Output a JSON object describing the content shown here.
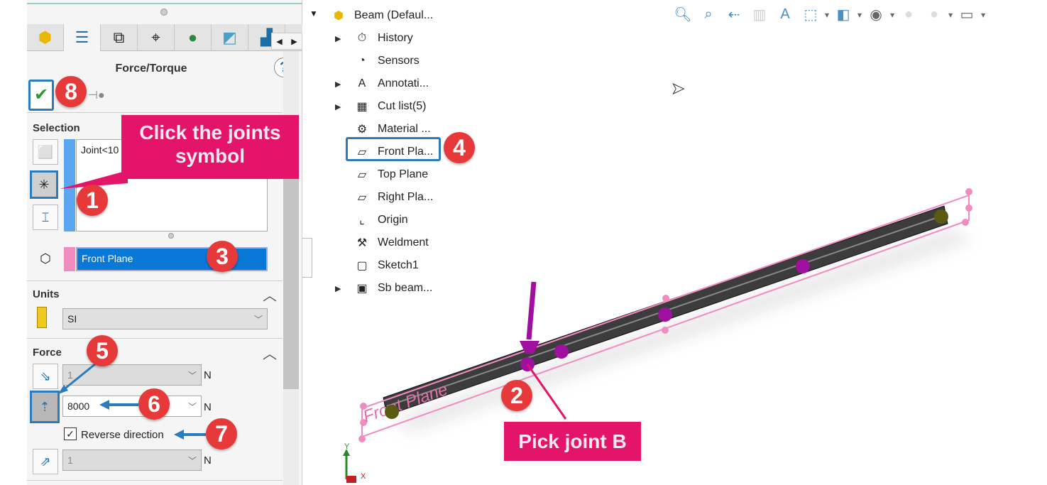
{
  "panel": {
    "title": "Force/Torque",
    "help_icon": "question-icon",
    "tabs": [
      "part-icon",
      "property-manager-icon",
      "config-icon",
      "dimxpert-icon",
      "appearance-icon",
      "display-pane-icon",
      "cam-icon"
    ],
    "selection": {
      "label": "Selection",
      "joints_value": "Joint<10",
      "plane_value": "Front Plane",
      "accent": "#5aa6f0",
      "plane_color": "#f08cc0"
    },
    "units": {
      "label": "Units",
      "value": "SI"
    },
    "force": {
      "label": "Force",
      "rows": [
        {
          "value": "1",
          "unit": "N",
          "enabled": false
        },
        {
          "value": "8000",
          "unit": "N",
          "enabled": true
        },
        {
          "value": "1",
          "unit": "N",
          "enabled": false
        }
      ],
      "reverse_label": "Reverse direction",
      "reverse_checked": true
    }
  },
  "tree": {
    "root": "Beam  (Defaul...",
    "items": [
      {
        "label": "History",
        "expandable": true
      },
      {
        "label": "Sensors",
        "expandable": false
      },
      {
        "label": "Annotati...",
        "expandable": true
      },
      {
        "label": "Cut list(5)",
        "expandable": true
      },
      {
        "label": "Material ...",
        "expandable": false
      },
      {
        "label": "Front Pla...",
        "expandable": false
      },
      {
        "label": "Top Plane",
        "expandable": false
      },
      {
        "label": "Right Pla...",
        "expandable": false
      },
      {
        "label": "Origin",
        "expandable": false
      },
      {
        "label": "Weldment",
        "expandable": false
      },
      {
        "label": "Sketch1",
        "expandable": false
      },
      {
        "label": "Sb beam...",
        "expandable": true
      }
    ]
  },
  "viewport": {
    "plane_label": "Front Plane",
    "axis_y": "Y",
    "axis_x": "X",
    "joint_symbol": "c"
  },
  "callouts": {
    "c1": "Click the joints symbol",
    "c2": "Pick joint B",
    "badges": [
      "1",
      "2",
      "3",
      "4",
      "5",
      "6",
      "7",
      "8"
    ]
  },
  "colors": {
    "callout": "#e5146b",
    "badge": "#e63a3a",
    "highlight": "#2b7bbd",
    "force": "#a0109f"
  }
}
